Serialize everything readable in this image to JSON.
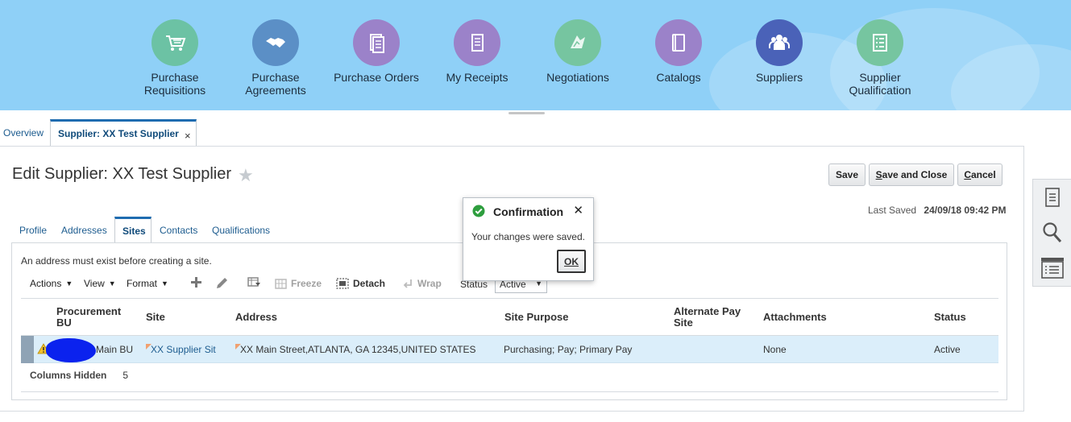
{
  "springboard": {
    "items": [
      {
        "label": "Purchase\nRequisitions",
        "icon": "shopping-cart-icon",
        "color": "#6cc2a4"
      },
      {
        "label": "Purchase\nAgreements",
        "icon": "handshake-icon",
        "color": "#5b8fc6"
      },
      {
        "label": "Purchase Orders",
        "icon": "document-icon",
        "color": "#9b82c9"
      },
      {
        "label": "My Receipts",
        "icon": "receipt-icon",
        "color": "#9b82c9"
      },
      {
        "label": "Negotiations",
        "icon": "negotiation-icon",
        "color": "#76c5a0"
      },
      {
        "label": "Catalogs",
        "icon": "catalog-icon",
        "color": "#9b82c9"
      },
      {
        "label": "Suppliers",
        "icon": "people-icon",
        "color": "#4a62b8"
      },
      {
        "label": "Supplier\nQualification",
        "icon": "checklist-icon",
        "color": "#76c5a0"
      }
    ]
  },
  "tabs": {
    "overview": "Overview",
    "active": "Supplier: XX Test Supplier",
    "close": "×"
  },
  "header": {
    "title": "Edit Supplier: XX Test Supplier",
    "save": "Save",
    "save_close_prefix": "S",
    "save_close_rest": "ave and Close",
    "cancel_prefix": "C",
    "cancel_rest": "ancel",
    "last_saved_label": "Last Saved",
    "last_saved_value": "24/09/18 09:42 PM"
  },
  "subtabs": {
    "profile": "Profile",
    "addresses": "Addresses",
    "sites": "Sites",
    "contacts": "Contacts",
    "qualifications": "Qualifications"
  },
  "sites": {
    "note": "An address must exist before creating a site.",
    "toolbar": {
      "actions": "Actions",
      "view": "View",
      "format": "Format",
      "freeze": "Freeze",
      "detach": "Detach",
      "wrap": "Wrap",
      "status_label": "Status",
      "status_value": "Active"
    },
    "columns": {
      "bu_line1": "Procurement",
      "bu_line2": "BU",
      "site": "Site",
      "address": "Address",
      "purpose": "Site Purpose",
      "alt_line1": "Alternate Pay",
      "alt_line2": "Site",
      "attachments": "Attachments",
      "status": "Status"
    },
    "rows": [
      {
        "bu": "Main BU",
        "site": "XX Supplier Sit",
        "address": "XX Main Street,ATLANTA, GA 12345,UNITED STATES",
        "purpose": "Purchasing; Pay; Primary Pay",
        "alt_pay_site": "",
        "attachments": "None",
        "status": "Active"
      }
    ],
    "columns_hidden_label": "Columns Hidden",
    "columns_hidden_value": "5"
  },
  "dialog": {
    "title": "Confirmation",
    "message": "Your changes were saved.",
    "ok": "OK",
    "close": "✕"
  }
}
